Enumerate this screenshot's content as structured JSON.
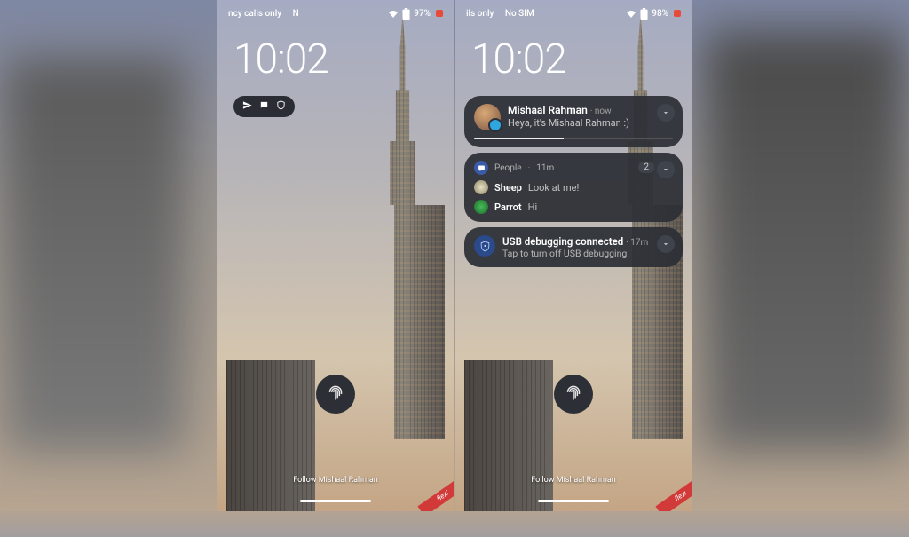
{
  "phones": {
    "left": {
      "status": {
        "network": "ncy calls only",
        "sim": "N",
        "wifi": true,
        "battery": "97%"
      },
      "clock": "10:02",
      "notif_icons": [
        "send",
        "chat",
        "shield"
      ],
      "follow": "Follow Mishaal Rahman",
      "ribbon": "flexi"
    },
    "right": {
      "status": {
        "network": "ils only",
        "sim": "No SIM",
        "wifi": true,
        "battery": "98%"
      },
      "clock": "10:02",
      "follow": "Follow Mishaal Rahman",
      "ribbon": "flexi",
      "notifications": {
        "n1": {
          "sender": "Mishaal Rahman",
          "time": "now",
          "body": "Heya, it's Mishaal Rahman :)"
        },
        "n2": {
          "app": "People",
          "time": "11m",
          "count": "2",
          "conversations": [
            {
              "name": "Sheep",
              "msg": "Look at me!"
            },
            {
              "name": "Parrot",
              "msg": "Hi"
            }
          ]
        },
        "n3": {
          "title": "USB debugging connected",
          "time": "17m",
          "body": "Tap to turn off USB debugging"
        }
      }
    }
  }
}
